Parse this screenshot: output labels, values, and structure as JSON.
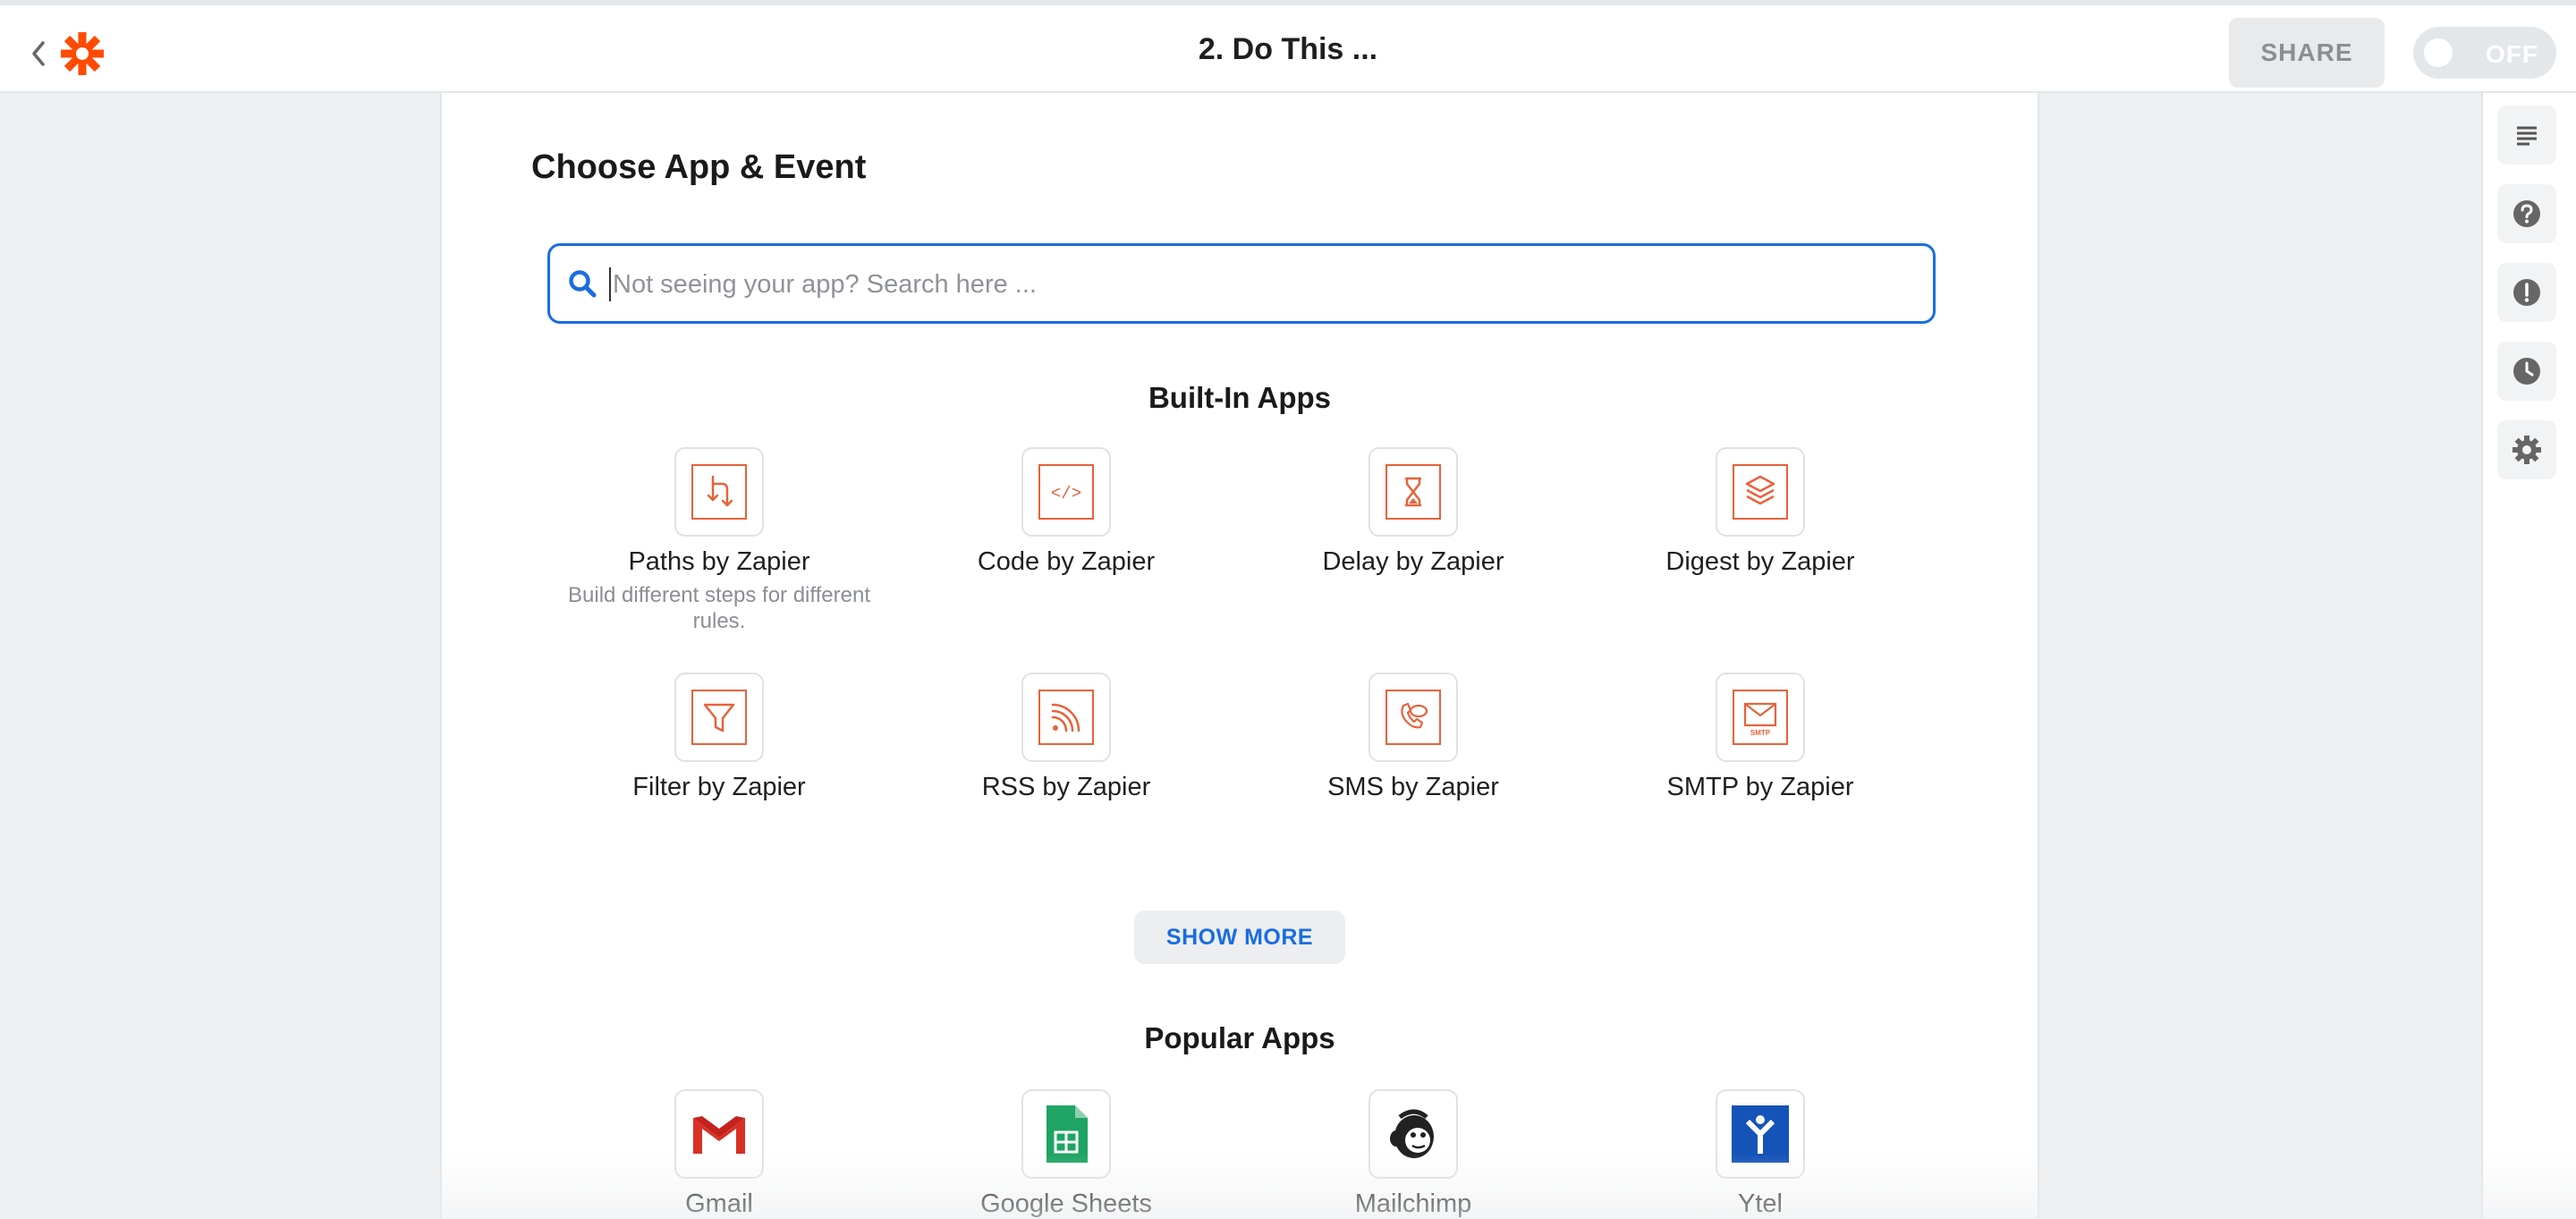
{
  "header": {
    "title": "2. Do This ...",
    "share_label": "SHARE",
    "toggle_label": "OFF"
  },
  "colors": {
    "accent": "#1a6de0",
    "brand": "#ff4a00",
    "icon_orange": "#e8623a"
  },
  "panel": {
    "heading": "Choose App & Event",
    "search": {
      "placeholder": "Not seeing your app? Search here ...",
      "value": ""
    },
    "builtin_title": "Built-In Apps",
    "builtin_apps": [
      {
        "name": "Paths by Zapier",
        "description": "Build different steps for different rules.",
        "icon": "paths-icon"
      },
      {
        "name": "Code by Zapier",
        "icon": "code-icon"
      },
      {
        "name": "Delay by Zapier",
        "icon": "hourglass-icon"
      },
      {
        "name": "Digest by Zapier",
        "icon": "layers-icon"
      },
      {
        "name": "Filter by Zapier",
        "icon": "filter-icon"
      },
      {
        "name": "RSS by Zapier",
        "icon": "rss-icon"
      },
      {
        "name": "SMS by Zapier",
        "icon": "sms-icon"
      },
      {
        "name": "SMTP by Zapier",
        "icon": "smtp-mail-icon"
      }
    ],
    "smtp_icon_text": "SMTP",
    "code_icon_text": "</>",
    "show_more_label": "SHOW MORE",
    "popular_title": "Popular Apps",
    "popular_apps": [
      {
        "name": "Gmail",
        "icon": "gmail-icon"
      },
      {
        "name": "Google Sheets",
        "icon": "google-sheets-icon"
      },
      {
        "name": "Mailchimp",
        "icon": "mailchimp-icon"
      },
      {
        "name": "Ytel",
        "icon": "ytel-icon"
      }
    ]
  },
  "right_rail": [
    "details-icon",
    "help-icon",
    "alert-icon",
    "history-icon",
    "settings-icon"
  ]
}
